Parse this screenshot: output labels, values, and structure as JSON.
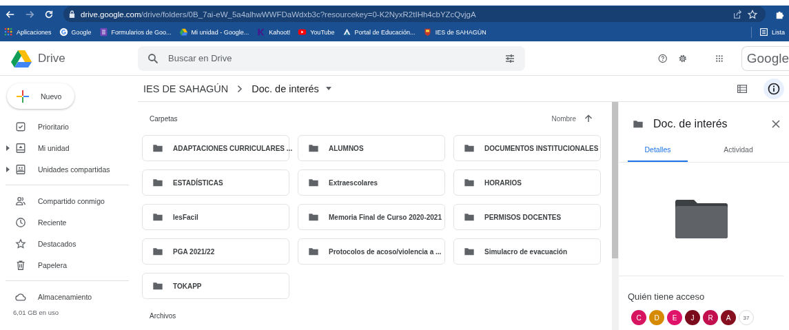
{
  "browser": {
    "url": {
      "host": "drive.google.com",
      "path": "/drive/folders/0B_7ai-eW_5a4alhwWWFDaWdxb3c?resourcekey=0-K2NyxR2tIHh4cbYZcQvjgA"
    },
    "bookmarks": [
      {
        "kind": "apps",
        "label": "Aplicaciones"
      },
      {
        "kind": "google",
        "label": "Google"
      },
      {
        "kind": "forms",
        "label": "Formularios de Goo..."
      },
      {
        "kind": "drive",
        "label": "Mi unidad - Google..."
      },
      {
        "kind": "kahoot",
        "label": "Kahoot!"
      },
      {
        "kind": "youtube",
        "label": "YouTube"
      },
      {
        "kind": "portal",
        "label": "Portal de Educación..."
      },
      {
        "kind": "crest",
        "label": "IES de SAHAGÚN"
      }
    ],
    "reading_list": "Lista"
  },
  "app": {
    "name": "Drive",
    "search": {
      "placeholder": "Buscar en Drive"
    },
    "account_label": "Google"
  },
  "sidebar": {
    "new_button": "Nuevo",
    "sections": [
      [
        {
          "kind": "priority",
          "label": "Prioritario",
          "expandable": false
        },
        {
          "kind": "drive",
          "label": "Mi unidad",
          "expandable": true
        },
        {
          "kind": "shared-drives",
          "label": "Unidades compartidas",
          "expandable": true
        }
      ],
      [
        {
          "kind": "shared",
          "label": "Compartido conmigo",
          "expandable": false
        },
        {
          "kind": "recent",
          "label": "Reciente",
          "expandable": false
        },
        {
          "kind": "starred",
          "label": "Destacados",
          "expandable": false
        },
        {
          "kind": "trash",
          "label": "Papelera",
          "expandable": false
        }
      ],
      [
        {
          "kind": "storage",
          "label": "Almacenamiento",
          "expandable": false
        }
      ]
    ],
    "storage_usage": "6,01 GB en uso"
  },
  "breadcrumb": [
    "IES DE SAHAGÚN",
    "Doc. de interés"
  ],
  "details_open": true,
  "folders_section": {
    "title": "Carpetas",
    "sort_label": "Nombre",
    "folders": [
      "ADAPTACIONES CURRICULARES ...",
      "ALUMNOS",
      "DOCUMENTOS INSTITUCIONALES",
      "ESTADÍSTICAS",
      "Extraescolares",
      "HORARIOS",
      "IesFacil",
      "Memoria Final de Curso 2020-2021",
      "PERMISOS DOCENTES",
      "PGA 2021/22",
      "Protocolos de acoso/violencia a ...",
      "Simulacro de evacuación",
      "TOKAPP"
    ]
  },
  "files_section": {
    "title": "Archivos"
  },
  "details": {
    "title": "Doc. de interés",
    "tabs": [
      {
        "label": "Detalles",
        "selected": true
      },
      {
        "label": "Actividad",
        "selected": false
      }
    ],
    "access_title": "Quién tiene acceso",
    "people": [
      {
        "initial": "C",
        "color": "#d6145f"
      },
      {
        "initial": "D",
        "color": "#d68a00"
      },
      {
        "initial": "E",
        "color": "#e0136b"
      },
      {
        "initial": "J",
        "color": "#7b0a1c"
      },
      {
        "initial": "R",
        "color": "#c2104e"
      },
      {
        "initial": "A",
        "color": "#86101f"
      }
    ],
    "people_more": "37"
  }
}
